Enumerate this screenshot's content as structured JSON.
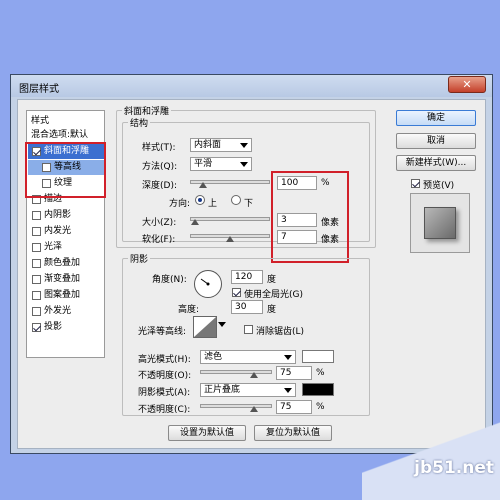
{
  "window": {
    "title": "图层样式",
    "close_glyph": "✕"
  },
  "sidebar": {
    "header": "样式",
    "blend_options": "混合选项:默认",
    "items": [
      {
        "label": "斜面和浮雕",
        "checked": true
      },
      {
        "label": "等高线",
        "checked": false
      },
      {
        "label": "纹理",
        "checked": false
      },
      {
        "label": "描边",
        "checked": false
      },
      {
        "label": "内阴影",
        "checked": false
      },
      {
        "label": "内发光",
        "checked": false
      },
      {
        "label": "光泽",
        "checked": false
      },
      {
        "label": "颜色叠加",
        "checked": false
      },
      {
        "label": "渐变叠加",
        "checked": false
      },
      {
        "label": "图案叠加",
        "checked": false
      },
      {
        "label": "外发光",
        "checked": false
      },
      {
        "label": "投影",
        "checked": true
      }
    ]
  },
  "bevel": {
    "section_title": "斜面和浮雕",
    "structure_title": "结构",
    "style_label": "样式(T):",
    "style_value": "内斜面",
    "technique_label": "方法(Q):",
    "technique_value": "平滑",
    "depth_label": "深度(D):",
    "depth_value": "100",
    "depth_unit": "%",
    "direction_label": "方向:",
    "dir_up": "上",
    "dir_down": "下",
    "size_label": "大小(Z):",
    "size_value": "3",
    "size_unit": "像素",
    "soften_label": "软化(F):",
    "soften_value": "7",
    "soften_unit": "像素"
  },
  "shading": {
    "title": "阴影",
    "angle_label": "角度(N):",
    "angle_value": "120",
    "angle_unit": "度",
    "global_light": "使用全局光(G)",
    "altitude_label": "高度:",
    "altitude_value": "30",
    "altitude_unit": "度",
    "gloss_label": "光泽等高线:",
    "antialias": "消除锯齿(L)",
    "highlight_label": "高光模式(H):",
    "highlight_value": "滤色",
    "highlight_opacity_label": "不透明度(O):",
    "highlight_opacity": "75",
    "shadow_label": "阴影模式(A):",
    "shadow_value": "正片叠底",
    "shadow_opacity_label": "不透明度(C):",
    "shadow_opacity": "75",
    "percent": "%"
  },
  "buttons": {
    "ok": "确定",
    "cancel": "取消",
    "new_style": "新建样式(W)...",
    "preview": "预览(V)",
    "make_default": "设置为默认值",
    "reset_default": "复位为默认值"
  },
  "colors": {
    "highlight_swatch": "#ffffff",
    "shadow_swatch": "#000000",
    "accent": "#3b6fd0",
    "annotation": "#d1202a"
  },
  "watermark": "jb51.net"
}
